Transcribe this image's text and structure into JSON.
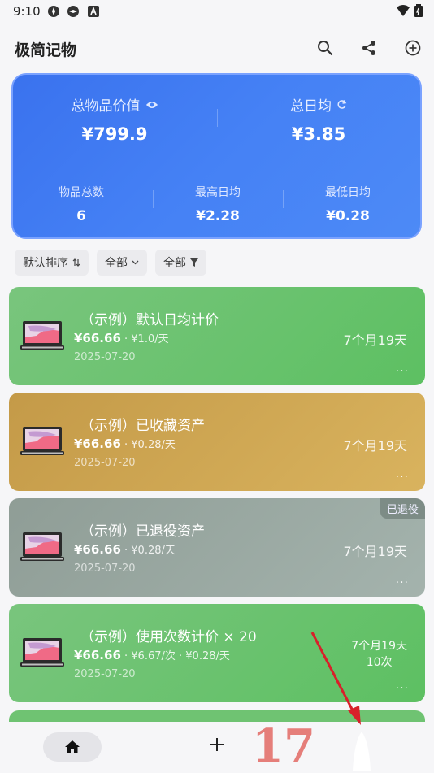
{
  "status_bar": {
    "time": "9:10"
  },
  "app_bar": {
    "title": "极简记物"
  },
  "summary": {
    "total_value_label": "总物品价值",
    "total_value": "¥799.9",
    "daily_avg_label": "总日均",
    "daily_avg": "¥3.85",
    "item_count_label": "物品总数",
    "item_count": "6",
    "max_daily_label": "最高日均",
    "max_daily": "¥2.28",
    "min_daily_label": "最低日均",
    "min_daily": "¥0.28"
  },
  "filters": {
    "sort_label": "默认排序",
    "category_label": "全部",
    "filter_label": "全部"
  },
  "items": [
    {
      "name": "（示例）默认日均计价",
      "price": "¥66.66",
      "rate": " · ¥1.0/天",
      "date": "2025-07-20",
      "duration": "7个月19天",
      "more": "..."
    },
    {
      "name": "（示例）已收藏资产",
      "price": "¥66.66",
      "rate": " · ¥0.28/天",
      "date": "2025-07-20",
      "duration": "7个月19天",
      "more": "..."
    },
    {
      "name": "（示例）已退役资产",
      "price": "¥66.66",
      "rate": " · ¥0.28/天",
      "date": "2025-07-20",
      "duration": "7个月19天",
      "more": "...",
      "badge": "已退役"
    },
    {
      "name": "（示例）使用次数计价 × 20",
      "price": "¥66.66",
      "rate": " · ¥6.67/次 · ¥0.28/天",
      "date": "2025-07-20",
      "duration": "7个月19天",
      "count": "10次",
      "more": "..."
    }
  ],
  "bottom_nav": {
    "overlay_number": "17"
  },
  "colors": {
    "green": "#5dc062",
    "gold": "#d9b35e",
    "grey": "#a4b3ad",
    "summary_blue": "#4581f5"
  }
}
